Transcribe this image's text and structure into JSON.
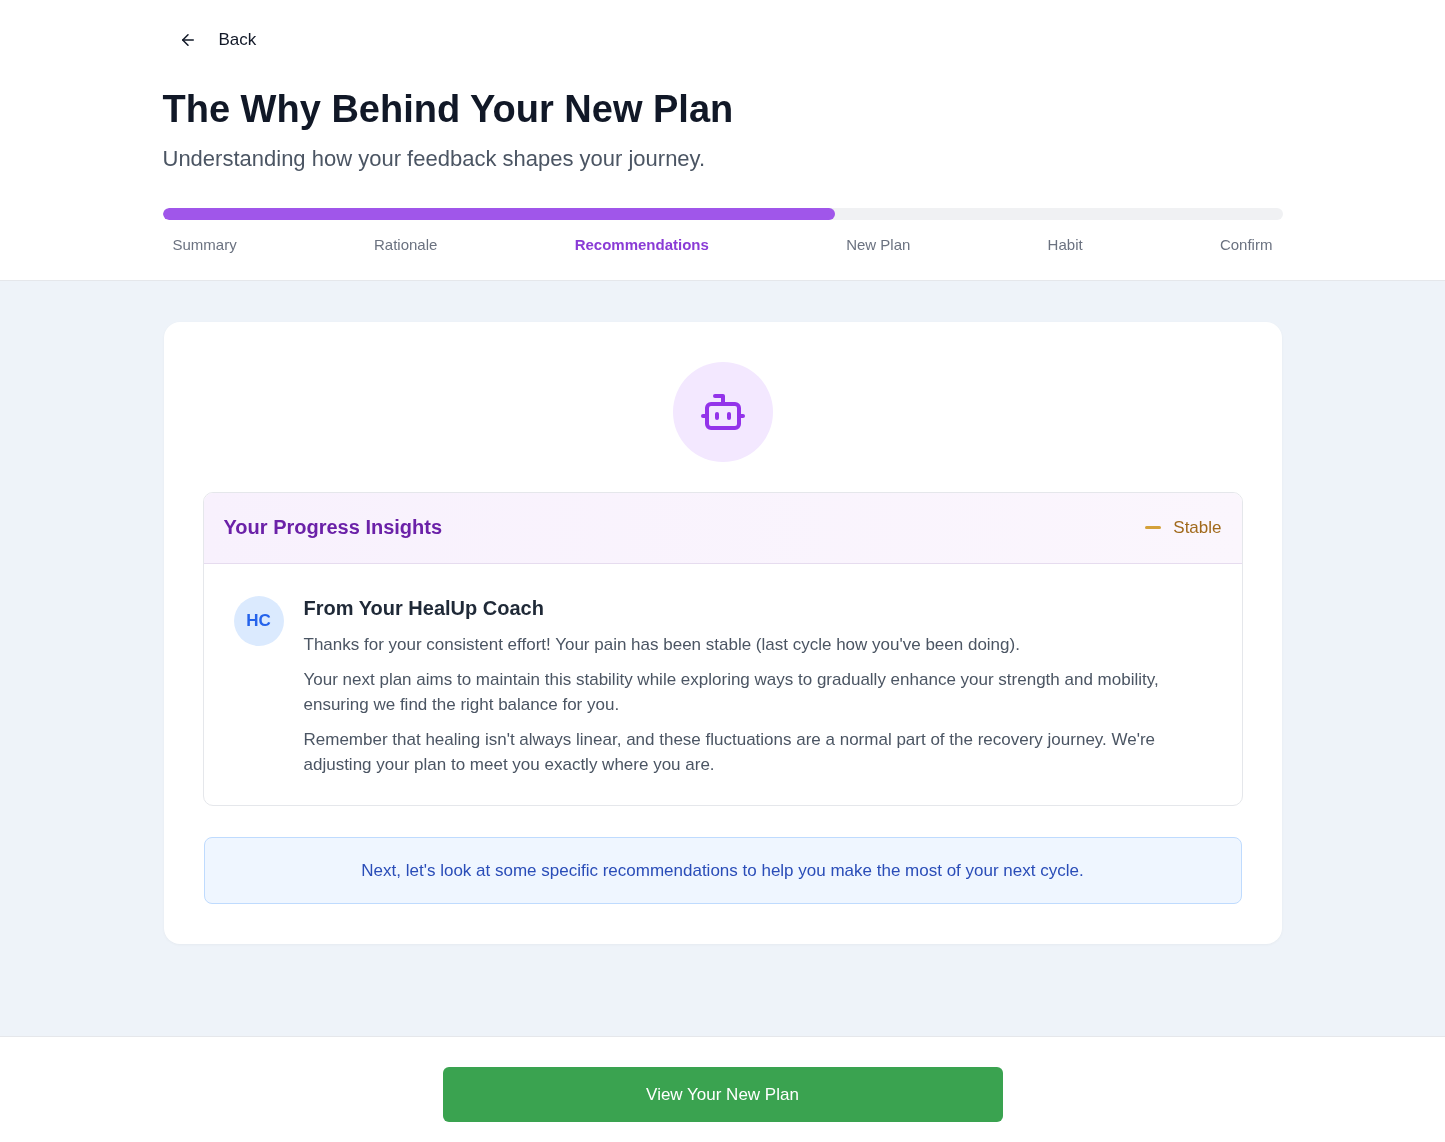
{
  "back": {
    "label": "Back"
  },
  "title": "The Why Behind Your New Plan",
  "subtitle": "Understanding how your feedback shapes your journey.",
  "progress": {
    "level": 0.6
  },
  "steps": [
    {
      "label": "Summary",
      "selected": false
    },
    {
      "label": "Rationale",
      "selected": false
    },
    {
      "label": "Recommendations",
      "selected": true
    },
    {
      "label": "New Plan",
      "selected": false
    },
    {
      "label": "Habit",
      "selected": false
    },
    {
      "label": "Confirm",
      "selected": false
    }
  ],
  "insights": {
    "title": "Your Progress Insights",
    "trend": {
      "kind": "stable",
      "label": "Stable"
    },
    "coach": {
      "initials": "HC",
      "name": "From Your HealUp Coach",
      "paragraphs": [
        "Thanks for your consistent effort! Your pain has been stable (last cycle how you've been doing).",
        "Your next plan aims to maintain this stability while exploring ways to gradually enhance your strength and mobility, ensuring we find the right balance for you.",
        "Remember that healing isn't always linear, and these fluctuations are a normal part of the recovery journey. We're adjusting your plan to meet you exactly where you are."
      ]
    }
  },
  "next_note": "Next, let's look at some specific recommendations to help you make the most of your next cycle.",
  "primary_button": "View Your New Plan"
}
